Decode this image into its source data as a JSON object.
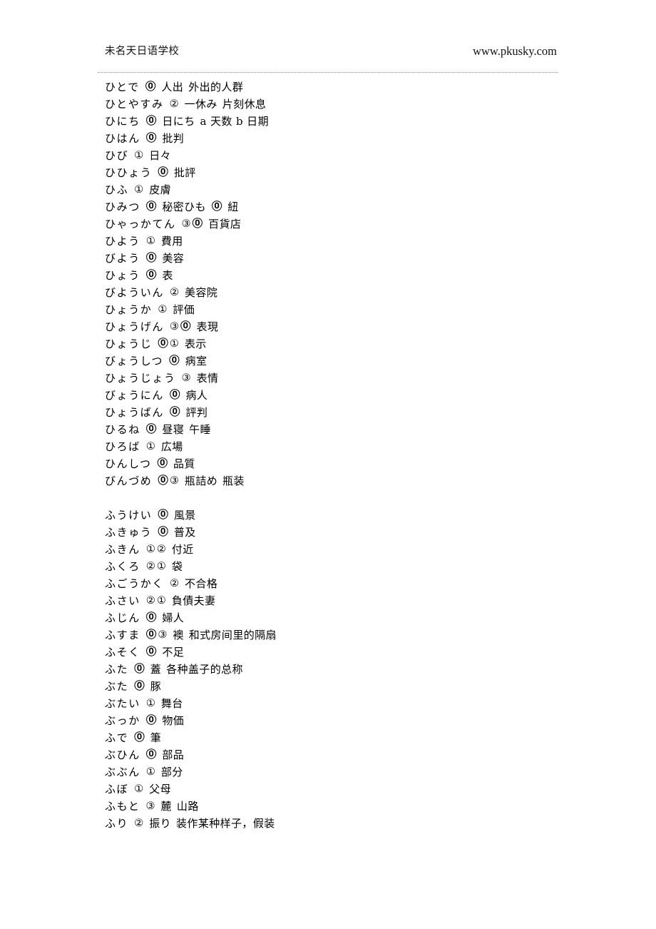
{
  "header": {
    "school_name": "未名天日语学校",
    "website": "www.pkusky.com"
  },
  "entries": [
    {
      "kana": "ひとで",
      "accents": [
        "0"
      ],
      "kanji": "人出",
      "gloss": "外出的人群"
    },
    {
      "kana": "ひとやすみ",
      "accents": [
        "2"
      ],
      "kanji": "一休み",
      "gloss": "片刻休息"
    },
    {
      "kana": "ひにち",
      "accents": [
        "0"
      ],
      "kanji": "日にち",
      "gloss": "a 天数 b 日期"
    },
    {
      "kana": "ひはん",
      "accents": [
        "0"
      ],
      "kanji": "批判",
      "gloss": ""
    },
    {
      "kana": "ひび",
      "accents": [
        "1"
      ],
      "kanji": "日々",
      "gloss": ""
    },
    {
      "kana": "ひひょう",
      "accents": [
        "0"
      ],
      "kanji": "批評",
      "gloss": ""
    },
    {
      "kana": "ひふ",
      "accents": [
        "1"
      ],
      "kanji": "皮膚",
      "gloss": ""
    },
    {
      "kana": "ひみつ",
      "accents": [
        "0"
      ],
      "kanji": "秘密ひも",
      "gloss": "",
      "extra_accents": [
        "0"
      ],
      "extra_kanji": "紐"
    },
    {
      "kana": "ひゃっかてん",
      "accents": [
        "3",
        "0"
      ],
      "kanji": "百貨店",
      "gloss": ""
    },
    {
      "kana": "ひよう",
      "accents": [
        "1"
      ],
      "kanji": "費用",
      "gloss": ""
    },
    {
      "kana": "びよう",
      "accents": [
        "0"
      ],
      "kanji": "美容",
      "gloss": ""
    },
    {
      "kana": "ひょう",
      "accents": [
        "0"
      ],
      "kanji": "表",
      "gloss": ""
    },
    {
      "kana": "びよういん",
      "accents": [
        "2"
      ],
      "kanji": "美容院",
      "gloss": ""
    },
    {
      "kana": "ひょうか",
      "accents": [
        "1"
      ],
      "kanji": "評価",
      "gloss": ""
    },
    {
      "kana": "ひょうげん",
      "accents": [
        "3",
        "0"
      ],
      "kanji": "表現",
      "gloss": ""
    },
    {
      "kana": "ひょうじ",
      "accents": [
        "0",
        "1"
      ],
      "kanji": "表示",
      "gloss": ""
    },
    {
      "kana": "びょうしつ",
      "accents": [
        "0"
      ],
      "kanji": "病室",
      "gloss": ""
    },
    {
      "kana": "ひょうじょう",
      "accents": [
        "3"
      ],
      "kanji": "表情",
      "gloss": ""
    },
    {
      "kana": "びょうにん",
      "accents": [
        "0"
      ],
      "kanji": "病人",
      "gloss": ""
    },
    {
      "kana": "ひょうばん",
      "accents": [
        "0"
      ],
      "kanji": "評判",
      "gloss": ""
    },
    {
      "kana": "ひるね",
      "accents": [
        "0"
      ],
      "kanji": "昼寝",
      "gloss": "午睡"
    },
    {
      "kana": "ひろば",
      "accents": [
        "1"
      ],
      "kanji": "広場",
      "gloss": ""
    },
    {
      "kana": "ひんしつ",
      "accents": [
        "0"
      ],
      "kanji": "品質",
      "gloss": ""
    },
    {
      "kana": "びんづめ",
      "accents": [
        "0",
        "3"
      ],
      "kanji": "瓶詰め",
      "gloss": "瓶装"
    },
    {
      "spacer": true
    },
    {
      "kana": "ふうけい",
      "accents": [
        "0"
      ],
      "kanji": "風景",
      "gloss": ""
    },
    {
      "kana": "ふきゅう",
      "accents": [
        "0"
      ],
      "kanji": "普及",
      "gloss": ""
    },
    {
      "kana": "ふきん",
      "accents": [
        "1",
        "2"
      ],
      "kanji": "付近",
      "gloss": ""
    },
    {
      "kana": "ふくろ",
      "accents": [
        "2",
        "1"
      ],
      "kanji": "袋",
      "gloss": ""
    },
    {
      "kana": "ふごうかく",
      "accents": [
        "2"
      ],
      "kanji": "不合格",
      "gloss": ""
    },
    {
      "kana": "ふさい",
      "accents": [
        "2",
        "1"
      ],
      "kanji": "負債夫妻",
      "gloss": ""
    },
    {
      "kana": "ふじん",
      "accents": [
        "0"
      ],
      "kanji": "婦人",
      "gloss": ""
    },
    {
      "kana": "ふすま",
      "accents": [
        "0",
        "3"
      ],
      "kanji": "襖",
      "gloss": "和式房间里的隔扇"
    },
    {
      "kana": "ふそく",
      "accents": [
        "0"
      ],
      "kanji": "不足",
      "gloss": ""
    },
    {
      "kana": "ふた",
      "accents": [
        "0"
      ],
      "kanji": "蓋",
      "gloss": "各种盖子的总称"
    },
    {
      "kana": "ぶた",
      "accents": [
        "0"
      ],
      "kanji": "豚",
      "gloss": ""
    },
    {
      "kana": "ぶたい",
      "accents": [
        "1"
      ],
      "kanji": "舞台",
      "gloss": ""
    },
    {
      "kana": "ぶっか",
      "accents": [
        "0"
      ],
      "kanji": "物価",
      "gloss": ""
    },
    {
      "kana": "ふで",
      "accents": [
        "0"
      ],
      "kanji": "筆",
      "gloss": ""
    },
    {
      "kana": "ぶひん",
      "accents": [
        "0"
      ],
      "kanji": "部品",
      "gloss": ""
    },
    {
      "kana": "ぶぶん",
      "accents": [
        "1"
      ],
      "kanji": "部分",
      "gloss": ""
    },
    {
      "kana": "ふぼ",
      "accents": [
        "1"
      ],
      "kanji": "父母",
      "gloss": ""
    },
    {
      "kana": "ふもと",
      "accents": [
        "3"
      ],
      "kanji": "麓",
      "gloss": "山路"
    },
    {
      "kana": "ふり",
      "accents": [
        "2"
      ],
      "kanji": "振り",
      "gloss": "装作某种样子，假装"
    }
  ]
}
